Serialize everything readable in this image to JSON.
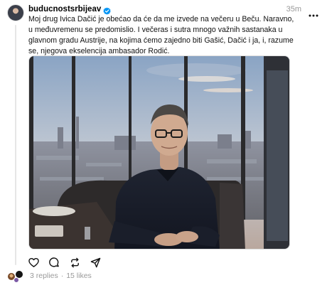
{
  "post": {
    "username": "buducnostsrbijeav",
    "verified": true,
    "time": "35m",
    "text": "Moj drug Ivica Dačić je obećao da će da me izvede na večeru u Beču. Naravno, u međuvremenu se predomislio. I večeras i sutra mnogo važnih sastanaka u glavnom gradu Austrije, na kojima ćemo zajedno biti Gašić, Dačić i ja, i, razume se, njegova ekselencija ambasador Rodić.",
    "icons": {
      "more": "more-horizontal-icon",
      "like": "heart-icon",
      "reply": "comment-icon",
      "repost": "repost-icon",
      "share": "send-icon",
      "verified": "verified-badge-icon"
    },
    "stats": {
      "replies": "3 replies",
      "separator": "·",
      "likes": "15 likes"
    }
  },
  "colors": {
    "verified": "#0095f6",
    "muted": "#999999",
    "thread_line": "#e6e6e6"
  }
}
